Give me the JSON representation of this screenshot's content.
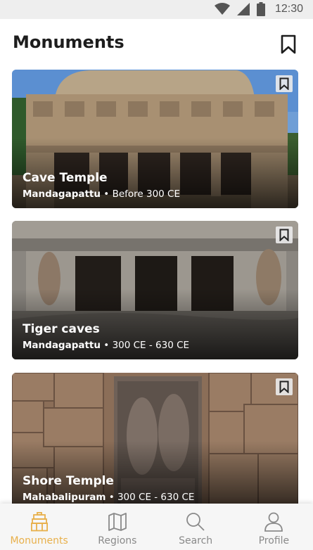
{
  "status_bar": {
    "time": "12:30",
    "icons": [
      "wifi-icon",
      "signal-icon",
      "battery-icon"
    ]
  },
  "header": {
    "title": "Monuments",
    "bookmark_icon": "bookmark-outline-icon"
  },
  "monuments": [
    {
      "title": "Cave Temple",
      "location": "Mandagapattu",
      "separator": "•",
      "period": "Before 300 CE",
      "bookmarked": false
    },
    {
      "title": "Tiger caves",
      "location": "Mandagapattu",
      "separator": "•",
      "period": "300 CE - 630 CE",
      "bookmarked": false
    },
    {
      "title": "Shore Temple",
      "location": "Mahabalipuram",
      "separator": "•",
      "period": "300 CE - 630 CE",
      "bookmarked": false
    }
  ],
  "bottom_nav": {
    "active_index": 0,
    "active_color": "#e8b04b",
    "inactive_color": "#8a8a8a",
    "items": [
      {
        "label": "Monuments",
        "icon": "monument-icon"
      },
      {
        "label": "Regions",
        "icon": "map-icon"
      },
      {
        "label": "Search",
        "icon": "search-icon"
      },
      {
        "label": "Profile",
        "icon": "user-icon"
      }
    ]
  }
}
